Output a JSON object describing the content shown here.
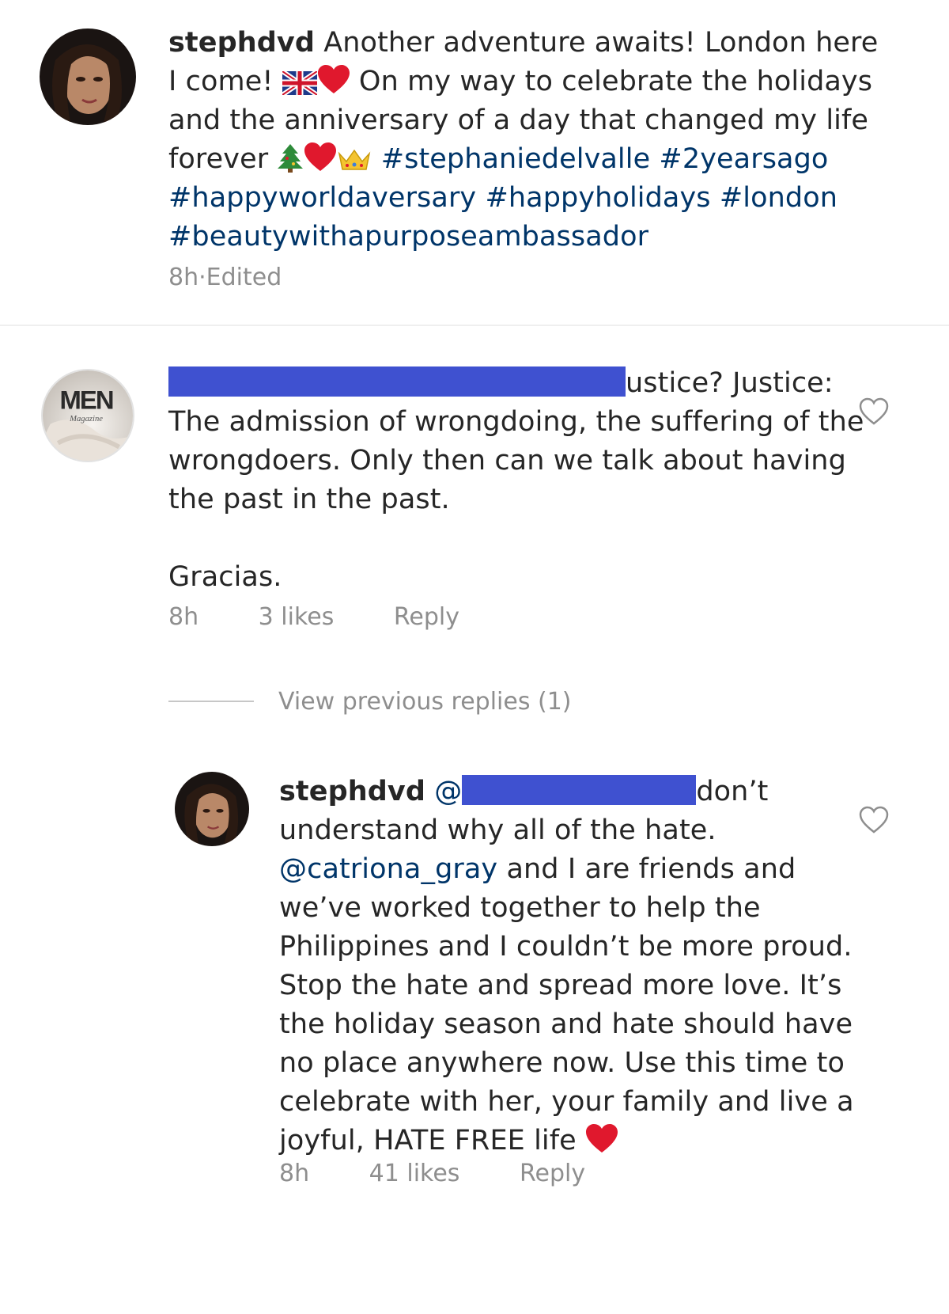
{
  "post": {
    "username": "stephdvd",
    "line1_text": " Another adventure awaits! London here",
    "line2_a": "I come! ",
    "line2_b": " On my way to celebrate the holidays",
    "line3": "and the anniversary of a day that changed my life",
    "line4_a": "forever ",
    "line4_hashtags": "#stephaniedelvalle #2yearsago",
    "line5_hashtags": "#happyworldaversary #happyholidays #london",
    "line6_hashtags": "#beautywithapurposeambassador",
    "time": "8h",
    "separator": " · ",
    "edited": "Edited"
  },
  "comment": {
    "avatar_brand": "MEN",
    "avatar_sub": "Magazine",
    "line1_visible": "ustice? Justice:",
    "line2": "The admission of wrongdoing, the suffering of the",
    "line3": "wrongdoers. Only then can we talk about having",
    "line4": "the past in the past.",
    "line5": "Gracias.",
    "time": "8h",
    "likes": "3 likes",
    "reply": "Reply",
    "view_previous": "View previous replies (1)"
  },
  "reply": {
    "username": "stephdvd",
    "mention_prefix": " @",
    "line1_tail": "don’t",
    "line2": "understand why all of the hate.",
    "line3_mention": "@catriona_gray",
    "line3_rest": " and I are friends and",
    "line4": "we’ve worked together to help the",
    "line5": "Philippines and I couldn’t be more proud.",
    "line6": "Stop the hate and spread more love. It’s",
    "line7": "the holiday season and hate should have",
    "line8": "no place anywhere now. Use this time to",
    "line9": "celebrate with her, your family and live a",
    "line10": "joyful, HATE FREE life ",
    "time": "8h",
    "likes": "41 likes",
    "reply": "Reply"
  },
  "colors": {
    "text": "#262626",
    "hashtag": "#003569",
    "meta": "#8e8e8e",
    "redaction": "#3f51d0",
    "heart_emoji": "#e0182d"
  },
  "icons": [
    "uk-flag-icon",
    "red-heart-icon",
    "christmas-tree-icon",
    "crown-icon",
    "heart-outline-icon"
  ]
}
